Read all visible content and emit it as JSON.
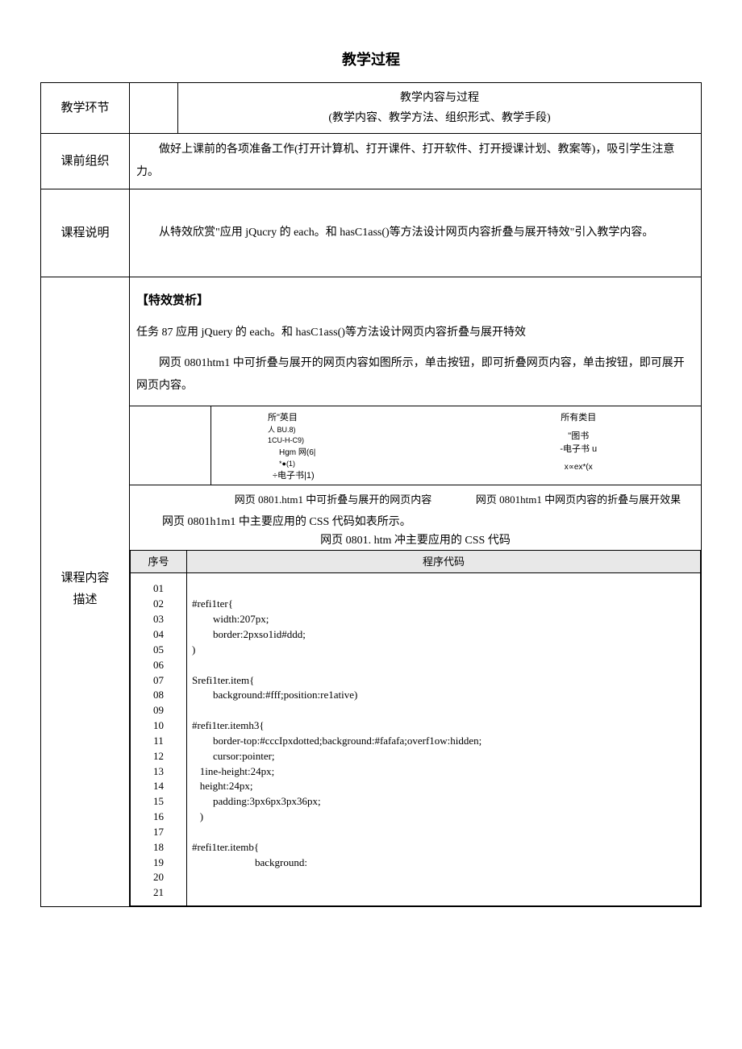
{
  "title": "教学过程",
  "header": {
    "col1": "教学环节",
    "col2_line1": "教学内容与过程",
    "col2_line2": "(教学内容、教学方法、组织形式、教学手段)"
  },
  "rows": {
    "pre_class": {
      "label": "课前组织",
      "text": "做好上课前的各项准备工作(打开计算机、打开课件、打开软件、打开授课计划、教案等)，吸引学生注意力。"
    },
    "course_desc": {
      "label": "课程说明",
      "text": "从特效欣赏\"应用 jQucry 的 each。和 hasC1ass()等方法设计网页内容折叠与展开特效\"引入教学内容。"
    },
    "content": {
      "label_line1": "课程内容",
      "label_line2": "描述",
      "heading": "【特效赏析】",
      "task_line": "任务 87 应用 jQuery 的 each。和 hasC1ass()等方法设计网页内容折叠与展开特效",
      "para1": "网页 0801htm1 中可折叠与展开的网页内容如图所示，单击按钮，即可折叠网页内容，单击按钮，即可展开网页内容。",
      "figure": {
        "left": {
          "l1": "所\"英目",
          "l2": "人 BU.8)",
          "l3": "1CU-H-C9)",
          "l4": "Hgm 网(6|",
          "l5": "*●(1)",
          "l6": "÷电子书|1)"
        },
        "right": {
          "l1": "所有类目",
          "l2": "\"图书",
          "l3": "-电子书 u",
          "l4": "x∝ex*(x"
        },
        "cap_left": "网页 0801.htm1 中可折叠与展开的网页内容",
        "cap_right": "网页 0801htm1 中网页内容的折叠与展开效果"
      },
      "sub_note": "网页 0801h1m1 中主要应用的 CSS 代码如表所示。",
      "sub_note_center": "网页 0801. htm 冲主要应用的 CSS 代码",
      "code_table": {
        "h1": "序号",
        "h2": "程序代码",
        "nums": "01\n02\n03\n04\n05\n06\n07\n08\n09\n10\n11\n12\n13\n14\n15\n16\n17\n18\n19\n20\n21",
        "code": "\n#refi1ter{\n        width:207px;\n        border:2pxso1id#ddd;\n)\n\nSrefi1ter.item{\n        background:#fff;position:re1ative)\n\n#refi1ter.itemh3{\n        border-top:#cccIpxdotted;background:#fafafa;overf1ow:hidden;\n        cursor:pointer;\n   1ine-height:24px;\n   height:24px;\n        padding:3px6px3px36px;\n   )\n\n#refi1ter.itemb{\n                        background:"
      }
    }
  }
}
